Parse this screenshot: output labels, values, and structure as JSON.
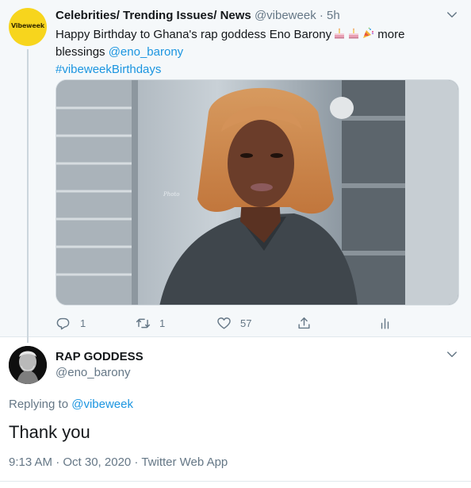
{
  "tweet": {
    "author_name": "Celebrities/ Trending Issues/ News",
    "author_handle": "@vibeweek",
    "time": "· 5h",
    "avatar_logo_text": "Vibeweek",
    "text_before": "Happy Birthday to Ghana's rap goddess Eno Barony",
    "emojis": [
      "birthday-cake-icon",
      "birthday-cake-icon",
      "party-popper-icon"
    ],
    "text_after": " more",
    "text_line2": "blessings ",
    "mention": "@eno_barony",
    "hashtag": "#vibeweekBirthdays",
    "photo_watermark": "Photographer signature",
    "actions": {
      "reply_count": "1",
      "retweet_count": "1",
      "like_count": "57"
    }
  },
  "reply": {
    "author_name": "RAP GODDESS",
    "author_handle": "@eno_barony",
    "replying_label": "Replying to ",
    "replying_to": "@vibeweek",
    "text": "Thank you",
    "timestamp": "9:13 AM · Oct 30, 2020 · Twitter Web App"
  },
  "colors": {
    "link": "#1b95e0",
    "muted": "#657786",
    "text": "#14171a",
    "avatar_yellow": "#f7d51d"
  }
}
